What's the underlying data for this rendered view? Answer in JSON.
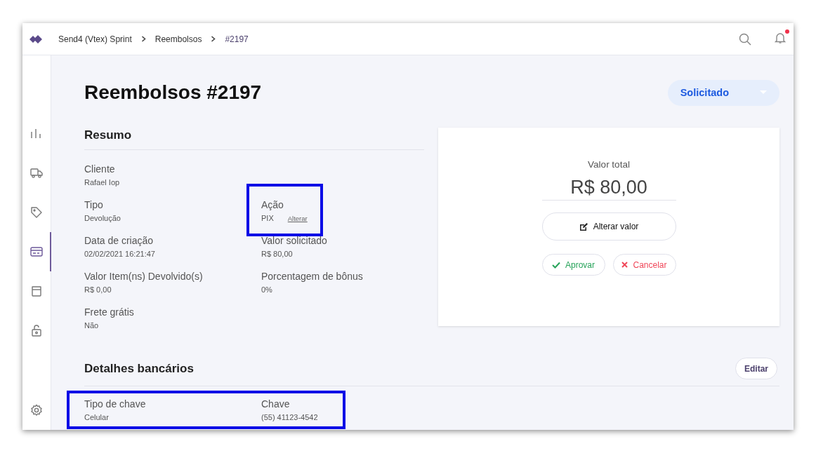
{
  "topbar": {
    "breadcrumb": [
      {
        "label": "Send4 (Vtex) Sprint"
      },
      {
        "label": "Reembolsos"
      },
      {
        "label": "#2197"
      }
    ],
    "notifications_unread": true
  },
  "sidebar": {
    "items": [
      {
        "kind": "chart",
        "selected": false
      },
      {
        "kind": "truck",
        "selected": false
      },
      {
        "kind": "tag",
        "selected": false
      },
      {
        "kind": "card",
        "selected": true
      },
      {
        "kind": "bag",
        "selected": false
      },
      {
        "kind": "lock",
        "selected": false
      }
    ],
    "bottom_item": {
      "kind": "gear",
      "selected": false
    }
  },
  "title": "Reembolsos #2197",
  "status": "Solicitado",
  "summary": {
    "heading": "Resumo",
    "rows": [
      [
        {
          "label": "Cliente",
          "value": "Rafael Iop",
          "highlighted": false
        }
      ],
      [
        {
          "label": "Tipo",
          "value": "Devolução",
          "highlighted": false
        },
        {
          "label": "Ação",
          "value": "PIX",
          "link": "Alterar",
          "highlighted": true
        }
      ],
      [
        {
          "label": "Data de criação",
          "value": "02/02/2021 16:21:47",
          "highlighted": false
        },
        {
          "label": "Valor solicitado",
          "value": "R$ 80,00",
          "highlighted": false
        }
      ],
      [
        {
          "label": "Valor Item(ns) Devolvido(s)",
          "value": "R$ 0,00",
          "highlighted": false
        },
        {
          "label": "Porcentagem de bônus",
          "value": "0%",
          "highlighted": false
        }
      ],
      [
        {
          "label": "Frete grátis",
          "value": "Não",
          "highlighted": false
        }
      ]
    ]
  },
  "total_card": {
    "label": "Valor total",
    "amount": "R$ 80,00",
    "edit_button": "Alterar valor",
    "approve_button": "Aprovar",
    "cancel_button": "Cancelar"
  },
  "bank": {
    "heading": "Detalhes bancários",
    "edit_button": "Editar",
    "highlighted": true,
    "fields": [
      {
        "label": "Tipo de chave",
        "value": "Celular"
      },
      {
        "label": "Chave",
        "value": "(55) 41123-4542"
      }
    ]
  }
}
